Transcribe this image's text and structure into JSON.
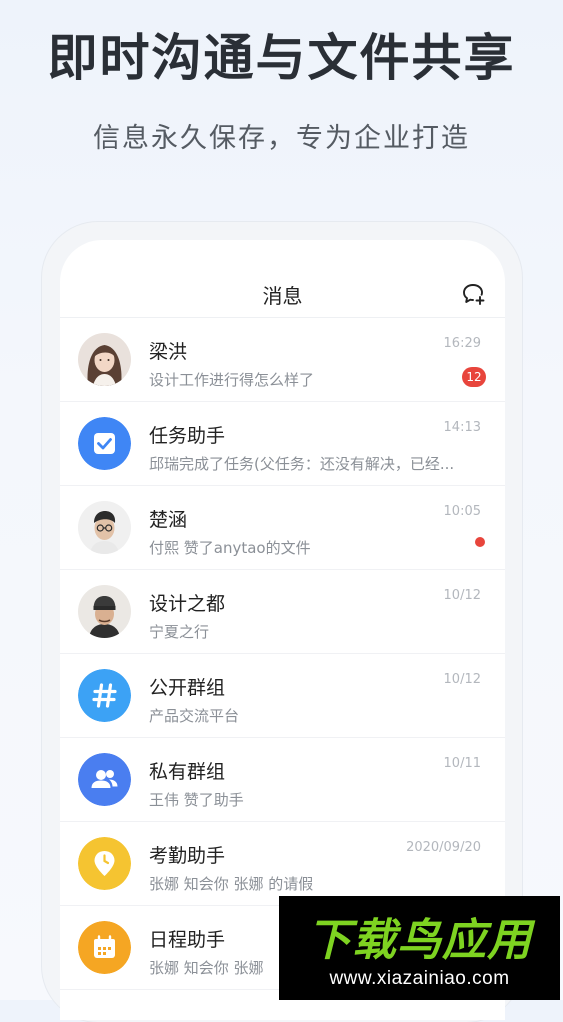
{
  "headline": "即时沟通与文件共享",
  "subline": "信息永久保存，专为企业打造",
  "topbar": {
    "title": "消息",
    "new_chat_icon": "new-chat-icon"
  },
  "messages": [
    {
      "name": "梁洪",
      "preview": "设计工作进行得怎么样了",
      "time": "16:29",
      "badge": "12",
      "avatar": "photo-woman"
    },
    {
      "name": "任务助手",
      "preview": "邱瑞完成了任务(父任务：还没有解决，已经...",
      "time": "14:13",
      "avatar": "task-check-icon",
      "avatar_color": "#3f86f5"
    },
    {
      "name": "楚涵",
      "preview": "付熙 赞了anytao的文件",
      "time": "10:05",
      "unread_dot": true,
      "avatar": "photo-man-glasses"
    },
    {
      "name": "设计之都",
      "preview": "宁夏之行",
      "time": "10/12",
      "avatar": "photo-man-beanie"
    },
    {
      "name": "公开群组",
      "preview": "产品交流平台",
      "time": "10/12",
      "avatar": "hash-icon",
      "avatar_color": "#3ca2f5"
    },
    {
      "name": "私有群组",
      "preview": "王伟 赞了助手",
      "time": "10/11",
      "avatar": "group-icon",
      "avatar_color": "#4a7ef0"
    },
    {
      "name": "考勤助手",
      "preview": "张娜 知会你 张娜 的请假",
      "time": "2020/09/20",
      "avatar": "location-clock-icon",
      "avatar_color": "#f5c431"
    },
    {
      "name": "日程助手",
      "preview": "张娜 知会你 张娜",
      "time": "",
      "avatar": "calendar-icon",
      "avatar_color": "#f5a623"
    }
  ],
  "watermark": {
    "title": "下载鸟应用",
    "url": "www.xiazainiao.com"
  },
  "colors": {
    "badge": "#e8453c",
    "watermark_green": "#7ed321"
  }
}
